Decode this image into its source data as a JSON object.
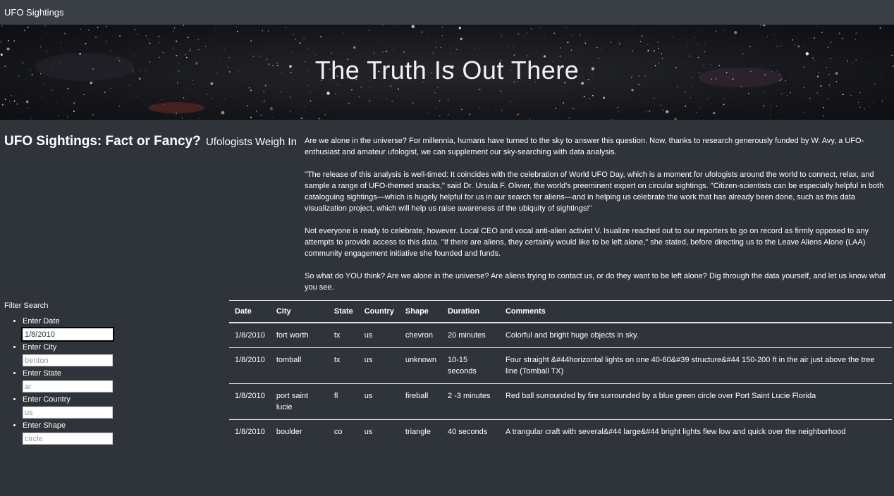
{
  "navbar": {
    "brand": "UFO Sightings"
  },
  "hero": {
    "title": "The Truth Is Out There"
  },
  "headline": {
    "main": "UFO Sightings: Fact or Fancy?",
    "sub": "Ufologists Weigh In"
  },
  "article": {
    "paragraphs": [
      "Are we alone in the universe? For millennia, humans have turned to the sky to answer this question. Now, thanks to research generously funded by W. Avy, a UFO-enthusiast and amateur ufologist, we can supplement our sky-searching with data analysis.",
      "\"The release of this analysis is well-timed: It coincides with the celebration of World UFO Day, which is a moment for ufologists around the world to connect, relax, and sample a range of UFO-themed snacks,\" said Dr. Ursula F. Olivier, the world's preeminent expert on circular sightings. \"Citizen-scientists can be especially helpful in both cataloguing sightings—which is hugely helpful for us in our search for aliens—and in helping us celebrate the work that has already been done, such as this data visualization project, which will help us raise awareness of the ubiquity of sightings!\"",
      "Not everyone is ready to celebrate, however. Local CEO and vocal anti-alien activist V. Isualize reached out to our reporters to go on record as firmly opposed to any attempts to provide access to this data. \"If there are aliens, they certainly would like to be left alone,\" she stated, before directing us to the Leave Aliens Alone (LAA) community engagement initiative she founded and funds.",
      "So what do YOU think? Are we alone in the universe? Are aliens trying to contact us, or do they want to be left alone? Dig through the data yourself, and let us know what you see."
    ]
  },
  "filters": {
    "title": "Filter Search",
    "items": [
      {
        "label": "Enter Date",
        "value": "1/8/2010",
        "placeholder": "1/8/2010"
      },
      {
        "label": "Enter City",
        "value": "",
        "placeholder": "benton"
      },
      {
        "label": "Enter State",
        "value": "",
        "placeholder": "ar"
      },
      {
        "label": "Enter Country",
        "value": "",
        "placeholder": "us"
      },
      {
        "label": "Enter Shape",
        "value": "",
        "placeholder": "circle"
      }
    ]
  },
  "table": {
    "headers": [
      "Date",
      "City",
      "State",
      "Country",
      "Shape",
      "Duration",
      "Comments"
    ],
    "rows": [
      [
        "1/8/2010",
        "fort worth",
        "tx",
        "us",
        "chevron",
        "20 minutes",
        "Colorful and bright huge objects in sky."
      ],
      [
        "1/8/2010",
        "tomball",
        "tx",
        "us",
        "unknown",
        "10-15 seconds",
        "Four straight &#44horizontal lights on one 40-60&#39 structure&#44 150-200 ft in the air just above the tree line (Tomball TX)"
      ],
      [
        "1/8/2010",
        "port saint lucie",
        "fl",
        "us",
        "fireball",
        "2 -3 minutes",
        "Red ball surrounded by fire surrounded by a blue green circle over Port Saint Lucie Florida"
      ],
      [
        "1/8/2010",
        "boulder",
        "co",
        "us",
        "triangle",
        "40 seconds",
        "A trangular craft with several&#44 large&#44 bright lights flew low and quick over the neighborhood"
      ]
    ]
  }
}
